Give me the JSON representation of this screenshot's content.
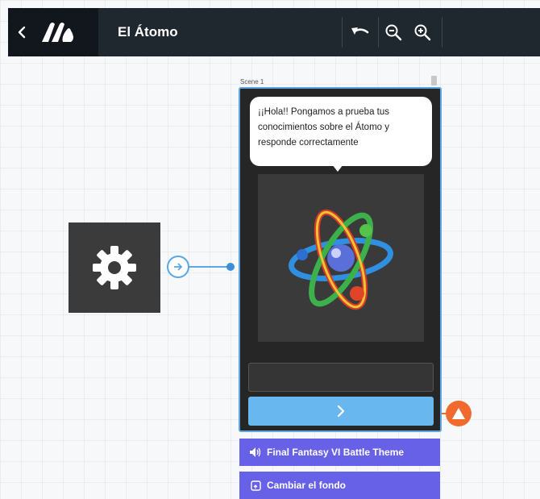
{
  "app": {
    "title": "El Átomo",
    "brand_color": "#1f272f"
  },
  "toolbar": {
    "icons": [
      "back-icon",
      "logo-icon",
      "undo-icon",
      "zoom-out-icon",
      "zoom-in-icon"
    ]
  },
  "scene": {
    "label": "Scene 1",
    "bubble_text": "¡¡Hola!! Pongamos a prueba tus conocimientos sobre el Átomo y responde correctamente",
    "image": "atom-illustration",
    "next_icon": "chevron-right-icon",
    "answer_value": ""
  },
  "nodes": {
    "settings_icon": "gear-icon",
    "warning_icon": "warning-icon"
  },
  "actions": {
    "music_label": "Final Fantasy VI Battle Theme",
    "background_label": "Cambiar el fondo"
  },
  "colors": {
    "accent": "#5aa6e6",
    "action_button": "#6761e8",
    "next_button": "#69b7ef",
    "warning": "#f06a30"
  }
}
